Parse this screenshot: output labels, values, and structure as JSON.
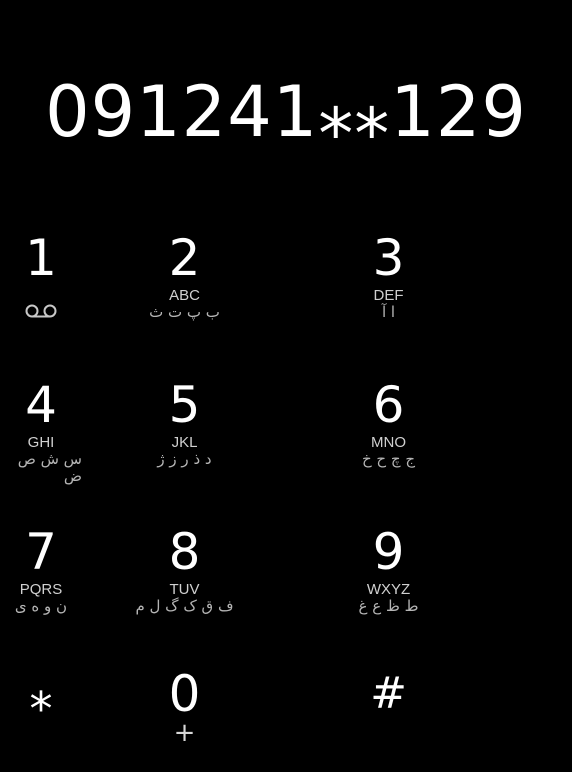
{
  "dialer": {
    "number": "091241⁎⁎129"
  },
  "keys": [
    {
      "digit": "1",
      "letters": "",
      "alt": ""
    },
    {
      "digit": "2",
      "letters": "ABC",
      "alt": "ب پ ت ث"
    },
    {
      "digit": "3",
      "letters": "DEF",
      "alt": "ا آ"
    },
    {
      "digit": "4",
      "letters": "GHI",
      "alt": "س ش ص ض"
    },
    {
      "digit": "5",
      "letters": "JKL",
      "alt": "د ذ ر ز ژ"
    },
    {
      "digit": "6",
      "letters": "MNO",
      "alt": "ج چ ح خ"
    },
    {
      "digit": "7",
      "letters": "PQRS",
      "alt": "ن و ه ی"
    },
    {
      "digit": "8",
      "letters": "TUV",
      "alt": "ف ق ک گ ل م"
    },
    {
      "digit": "9",
      "letters": "WXYZ",
      "alt": "ط ظ ع غ"
    },
    {
      "digit": "⁎",
      "letters": "",
      "alt": ""
    },
    {
      "digit": "0",
      "letters": "+",
      "alt": ""
    },
    {
      "digit": "#",
      "letters": "",
      "alt": ""
    }
  ],
  "icons": {
    "key1": "voicemail-icon"
  },
  "colors": {
    "background": "#000000",
    "text": "#ffffff",
    "secondary": "#d0d0d0"
  }
}
